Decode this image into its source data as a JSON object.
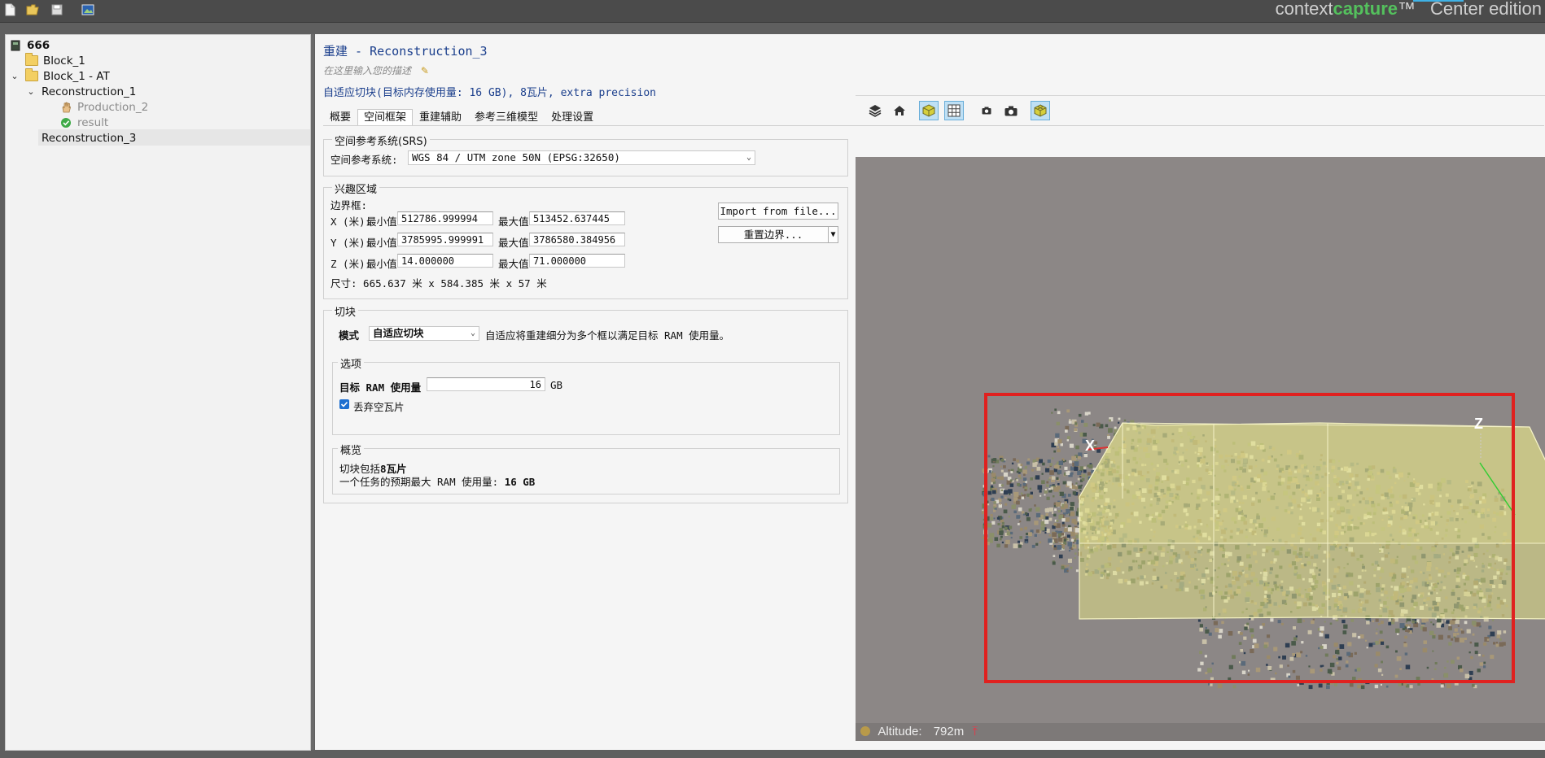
{
  "app": {
    "brand_part1": "context",
    "brand_part2": "capture",
    "brand_tm": "™",
    "brand_edition": "Center edition"
  },
  "toolbar": {
    "icons": [
      "new-file-icon",
      "open-folder-icon",
      "save-icon",
      "image-icon"
    ]
  },
  "tree": {
    "root": "666",
    "items": [
      {
        "label": "Block_1"
      },
      {
        "label": "Block_1 - AT"
      },
      {
        "label": "Reconstruction_1"
      },
      {
        "label": "Production_2"
      },
      {
        "label": "result"
      },
      {
        "label": "Reconstruction_3"
      }
    ]
  },
  "main": {
    "title": "重建 - Reconstruction_3",
    "description_placeholder": "在这里输入您的描述",
    "summary": "自适应切块(目标内存使用量: 16 GB), 8瓦片, extra precision",
    "tabs": [
      "概要",
      "空间框架",
      "重建辅助",
      "参考三维模型",
      "处理设置"
    ],
    "active_tab": "空间框架"
  },
  "srs": {
    "group_title": "空间参考系统(SRS)",
    "label": "空间参考系统:",
    "value": "WGS 84 / UTM zone 50N (EPSG:32650)"
  },
  "roi": {
    "group_title": "兴趣区域",
    "bbox_label": "边界框:",
    "x_label": "X (米):",
    "y_label": "Y (米):",
    "z_label": "Z (米):",
    "min_label": "最小值",
    "max_label": "最大值",
    "x_min": "512786.999994",
    "x_max": "513452.637445",
    "y_min": "3785995.999991",
    "y_max": "3786580.384956",
    "z_min": "14.000000",
    "z_max": "71.000000",
    "size": "尺寸: 665.637 米 x 584.385 米 x 57 米",
    "import_button": "Import from file...",
    "reset_button": "重置边界..."
  },
  "tiling": {
    "group_title": "切块",
    "mode_label": "模式",
    "mode_value": "自适应切块",
    "mode_hint": "自适应将重建细分为多个框以满足目标 RAM 使用量。",
    "options_title": "选项",
    "ram_label": "目标 RAM 使用量",
    "ram_value": "16",
    "ram_unit": "GB",
    "discard_label": "丢弃空瓦片",
    "discard_checked": true,
    "overview_title": "概览",
    "overview_line1_prefix": "切块包括",
    "overview_line1_value": "8瓦片",
    "overview_line2_prefix": "一个任务的预期最大 RAM 使用量:",
    "overview_line2_value": "16 GB"
  },
  "viewer": {
    "altitude_label": "Altitude:",
    "altitude_value": "792m",
    "axis_x": "X",
    "axis_z": "Z",
    "buttons": [
      "layers-icon",
      "home-icon",
      "box-icon",
      "grid-icon",
      "camera-small-icon",
      "camera-icon",
      "tiles-icon"
    ]
  }
}
